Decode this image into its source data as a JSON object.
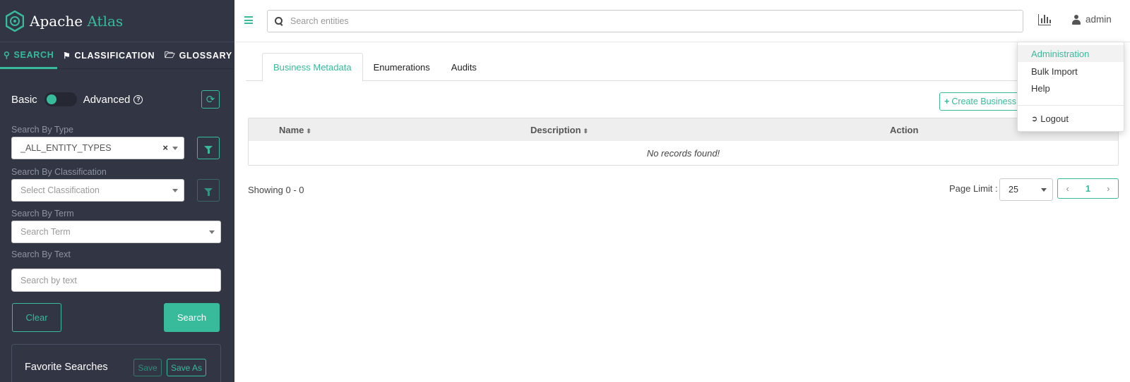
{
  "brand": {
    "name_part1": "Apache ",
    "name_part2": "Atlas",
    "accent_color": "#37bb9b"
  },
  "sidebar": {
    "tabs": [
      {
        "label": "SEARCH",
        "icon": "search-icon",
        "active": true
      },
      {
        "label": "CLASSIFICATION",
        "icon": "tag-icon",
        "active": false
      },
      {
        "label": "GLOSSARY",
        "icon": "folder-open-icon",
        "active": false
      }
    ],
    "toggle": {
      "left_label": "Basic",
      "right_label": "Advanced",
      "help_glyph": "?"
    },
    "fields": {
      "type_label": "Search By Type",
      "type_value": "_ALL_ENTITY_TYPES",
      "type_clear": "×",
      "classification_label": "Search By Classification",
      "classification_placeholder": "Select Classification",
      "term_label": "Search By Term",
      "term_placeholder": "Search Term",
      "text_label": "Search By Text",
      "text_placeholder": "Search by text"
    },
    "buttons": {
      "clear": "Clear",
      "search": "Search"
    },
    "favorites": {
      "title": "Favorite Searches",
      "save": "Save",
      "save_as": "Save As"
    }
  },
  "header": {
    "search_placeholder": "Search entities",
    "user": "admin"
  },
  "main": {
    "tabs": [
      {
        "label": "Business Metadata",
        "active": true
      },
      {
        "label": "Enumerations",
        "active": false
      },
      {
        "label": "Audits",
        "active": false
      }
    ],
    "create_button": "Create Business",
    "create_plus": "+",
    "table": {
      "columns": [
        "Name",
        "Description",
        "Action"
      ],
      "sort_glyph": "⬍",
      "empty_message": "No records found!"
    },
    "showing": "Showing 0 - 0",
    "page_limit_label": "Page Limit :",
    "page_limit_value": "25",
    "pager": {
      "prev": "‹",
      "page": "1",
      "next": "›"
    }
  },
  "dropdown": {
    "items": [
      "Administration",
      "Bulk Import",
      "Help"
    ],
    "logout": "Logout"
  }
}
